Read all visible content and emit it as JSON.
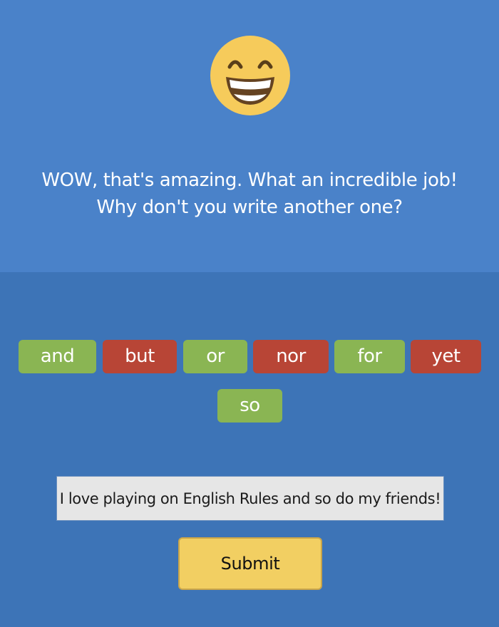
{
  "feedback": {
    "emoji": "grinning-face-with-smiling-eyes",
    "line1": "WOW, that's amazing. What an incredible job!",
    "line2": "Why don't you write another one?"
  },
  "conjunctions": [
    {
      "label": "and",
      "color": "green"
    },
    {
      "label": "but",
      "color": "red"
    },
    {
      "label": "or",
      "color": "green"
    },
    {
      "label": "nor",
      "color": "red"
    },
    {
      "label": "for",
      "color": "green"
    },
    {
      "label": "yet",
      "color": "red"
    },
    {
      "label": "so",
      "color": "green"
    }
  ],
  "sentence_input": {
    "value": "I love playing on English Rules and so do my friends!"
  },
  "submit": {
    "label": "Submit"
  },
  "colors": {
    "top_background": "#4a82c9",
    "bottom_background": "#3d74b7",
    "green": "#8ab553",
    "red": "#b84536",
    "submit": "#f2cf62"
  }
}
